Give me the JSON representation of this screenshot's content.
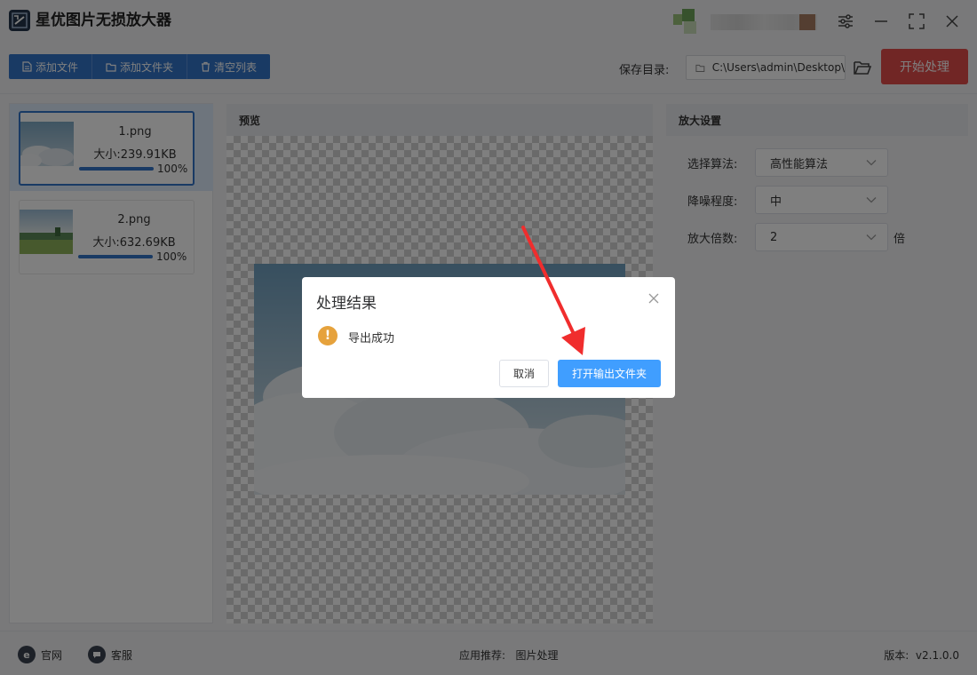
{
  "app": {
    "title": "星优图片无损放大器"
  },
  "toolbar": {
    "add_file": "添加文件",
    "add_folder": "添加文件夹",
    "clear_list": "清空列表",
    "save_dir_label": "保存目录:",
    "save_dir_path": "C:\\Users\\admin\\Desktop\\",
    "start": "开始处理"
  },
  "files": [
    {
      "name": "1.png",
      "size": "大小:239.91KB",
      "progress_text": "100%",
      "progress": 1.0,
      "selected": true
    },
    {
      "name": "2.png",
      "size": "大小:632.69KB",
      "progress_text": "100%",
      "progress": 1.0,
      "selected": false
    }
  ],
  "preview": {
    "title": "预览"
  },
  "settings": {
    "title": "放大设置",
    "algorithm_label": "选择算法:",
    "algorithm_value": "高性能算法",
    "denoise_label": "降噪程度:",
    "denoise_value": "中",
    "scale_label": "放大倍数:",
    "scale_value": "2",
    "scale_unit": "倍"
  },
  "footer": {
    "website": "官网",
    "support": "客服",
    "recommend": "应用推荐:   图片处理",
    "version": "版本:  v2.1.0.0"
  },
  "dialog": {
    "title": "处理结果",
    "message": "导出成功",
    "cancel": "取消",
    "open_folder": "打开输出文件夹"
  },
  "colors": {
    "primary": "#3375c8",
    "start_button": "#e34d4b",
    "dialog_button": "#409eff",
    "warning": "#e6a23c",
    "annotation_arrow": "#f02d2d"
  },
  "icons": [
    "app-logo-icon",
    "settings-sliders-icon",
    "minimize-icon",
    "maximize-icon",
    "close-icon",
    "file-icon",
    "folder-icon",
    "trash-icon",
    "folder-open-icon",
    "chevron-down-icon",
    "website-icon",
    "support-icon",
    "warning-icon"
  ]
}
